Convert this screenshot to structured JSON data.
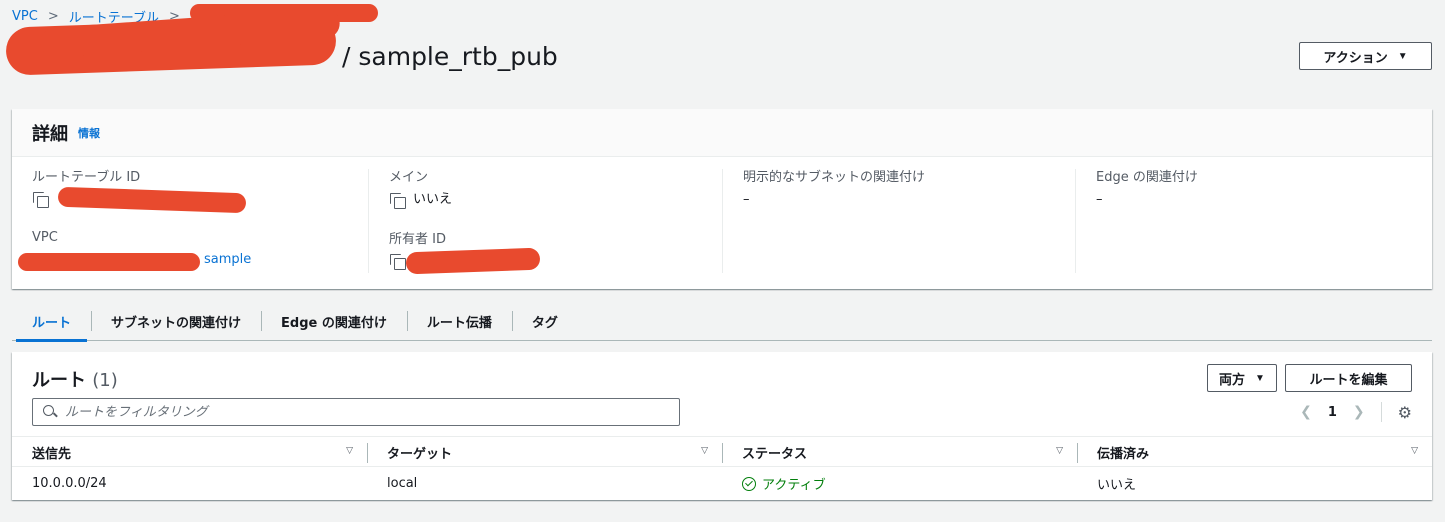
{
  "breadcrumb": {
    "items": [
      "VPC",
      "ルートテーブル"
    ],
    "separator": ">"
  },
  "page": {
    "title_suffix": "/ sample_rtb_pub",
    "actions_label": "アクション"
  },
  "details": {
    "title": "詳細",
    "info_label": "情報",
    "fields": {
      "route_table_id": {
        "label": "ルートテーブル ID"
      },
      "main": {
        "label": "メイン",
        "value": "いいえ"
      },
      "explicit_subnet": {
        "label": "明示的なサブネットの関連付け",
        "value": "–"
      },
      "edge": {
        "label": "Edge の関連付け",
        "value": "–"
      },
      "vpc": {
        "label": "VPC",
        "value_suffix": "sample"
      },
      "owner_id": {
        "label": "所有者 ID"
      }
    }
  },
  "tabs": [
    "ルート",
    "サブネットの関連付け",
    "Edge の関連付け",
    "ルート伝播",
    "タグ"
  ],
  "routes": {
    "title": "ルート",
    "count": "(1)",
    "filter_select": "両方",
    "edit_button": "ルートを編集",
    "search_placeholder": "ルートをフィルタリング",
    "page_number": "1",
    "columns": [
      "送信先",
      "ターゲット",
      "ステータス",
      "伝播済み"
    ],
    "rows": [
      {
        "destination": "10.0.0.0/24",
        "target": "local",
        "status": "アクティブ",
        "propagated": "いいえ"
      }
    ]
  },
  "colors": {
    "link": "#0972d3",
    "success": "#037f0c",
    "redaction": "#e84a2e",
    "background": "#f2f3f3"
  }
}
